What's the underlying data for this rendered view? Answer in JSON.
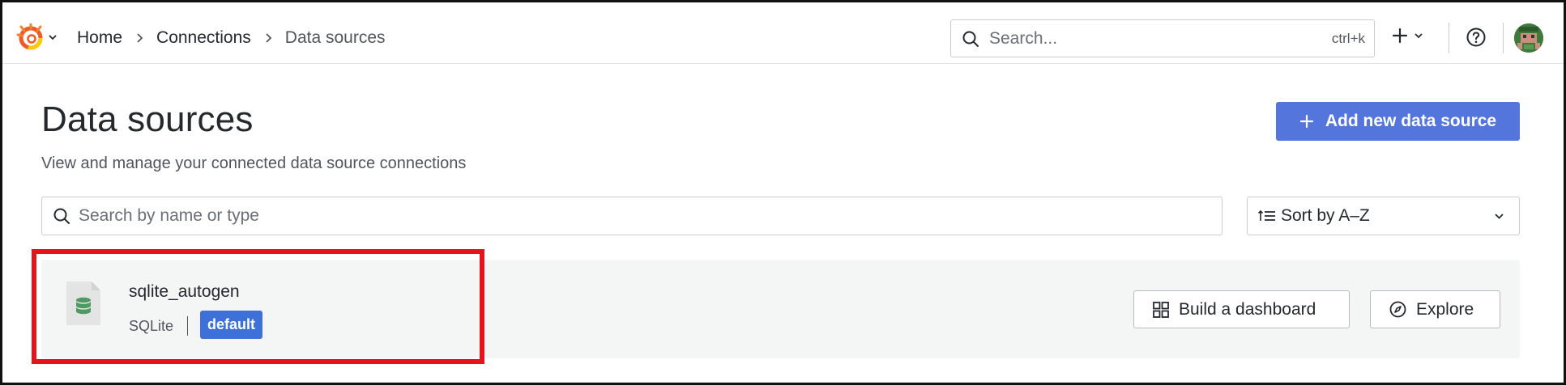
{
  "header": {
    "breadcrumbs": [
      {
        "label": "Home"
      },
      {
        "label": "Connections"
      },
      {
        "label": "Data sources"
      }
    ],
    "search": {
      "placeholder": "Search...",
      "shortcut": "ctrl+k"
    },
    "icons": [
      "grafana-logo-icon",
      "plus-icon",
      "help-icon",
      "avatar"
    ]
  },
  "page": {
    "title": "Data sources",
    "subtitle": "View and manage your connected data source connections",
    "add_button": "Add new data source"
  },
  "filters": {
    "search_placeholder": "Search by name or type",
    "sort_label": "Sort by A–Z"
  },
  "datasources": [
    {
      "name": "sqlite_autogen",
      "type": "SQLite",
      "badge": "default",
      "actions": {
        "build": "Build a dashboard",
        "explore": "Explore"
      }
    }
  ],
  "colors": {
    "primary": "#5476dc",
    "badge": "#3d71d9",
    "highlight": "#e3141a",
    "card_bg": "#f4f5f5"
  }
}
